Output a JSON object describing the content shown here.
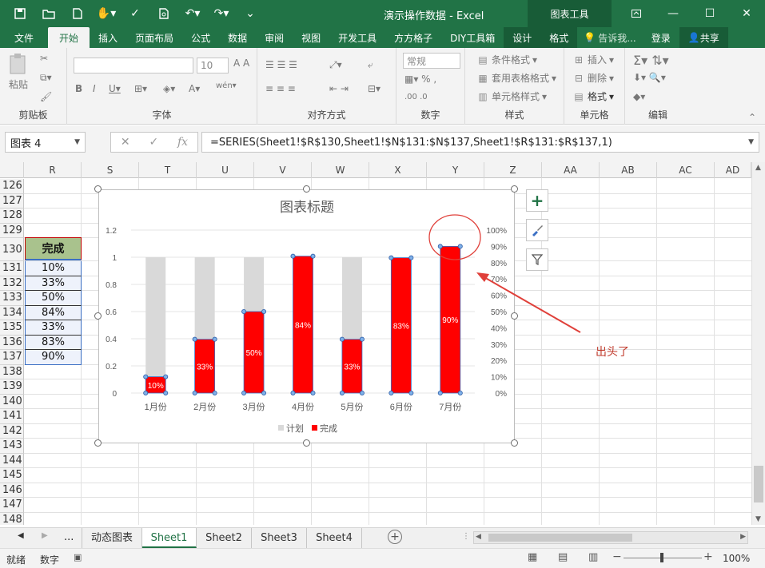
{
  "titlebar": {
    "title": "演示操作数据 - Excel",
    "context_tools": "图表工具"
  },
  "tabs": [
    "文件",
    "开始",
    "插入",
    "页面布局",
    "公式",
    "数据",
    "审阅",
    "视图",
    "开发工具",
    "方方格子",
    "DIY工具箱",
    "设计",
    "格式"
  ],
  "tell_me": "告诉我...",
  "login": "登录",
  "share": "共享",
  "ribbon": {
    "clipboard": {
      "paste": "粘贴",
      "label": "剪贴板"
    },
    "font": {
      "size": "10",
      "label": "字体"
    },
    "align": {
      "label": "对齐方式"
    },
    "number": {
      "format": "常规",
      "label": "数字"
    },
    "styles": {
      "cond": "条件格式",
      "table": "套用表格格式",
      "cell": "单元格样式",
      "label": "样式"
    },
    "cells": {
      "insert": "插入",
      "delete": "删除",
      "format": "格式",
      "label": "单元格"
    },
    "edit": {
      "label": "编辑"
    }
  },
  "namebox": "图表 4",
  "formula": "=SERIES(Sheet1!$R$130,Sheet1!$N$131:$N$137,Sheet1!$R$131:$R$137,1)",
  "columns": [
    "R",
    "S",
    "T",
    "U",
    "V",
    "W",
    "X",
    "Y",
    "Z",
    "AA",
    "AB",
    "AC",
    "AD"
  ],
  "rows": [
    "126",
    "127",
    "128",
    "129",
    "130",
    "131",
    "132",
    "133",
    "134",
    "135",
    "136",
    "137",
    "138",
    "139",
    "140",
    "141",
    "142",
    "143",
    "144",
    "145",
    "146",
    "147",
    "148"
  ],
  "table": {
    "header": "完成",
    "values": [
      "10%",
      "33%",
      "50%",
      "84%",
      "33%",
      "83%",
      "90%"
    ]
  },
  "annotation": "出头了",
  "sheets": [
    "动态图表",
    "Sheet1",
    "Sheet2",
    "Sheet3",
    "Sheet4"
  ],
  "sheet_more": "...",
  "status": {
    "ready": "就绪",
    "num": "数字",
    "zoom": "100%"
  },
  "chart_data": {
    "type": "bar",
    "title": "图表标题",
    "categories": [
      "1月份",
      "2月份",
      "3月份",
      "4月份",
      "5月份",
      "6月份",
      "7月份"
    ],
    "series": [
      {
        "name": "计划",
        "axis": "left",
        "values": [
          1,
          1,
          1,
          1,
          1,
          1,
          1
        ],
        "color": "#d9d9d9"
      },
      {
        "name": "完成",
        "axis": "right",
        "values": [
          0.1,
          0.33,
          0.5,
          0.84,
          0.33,
          0.83,
          0.9
        ],
        "color": "#ff0000"
      }
    ],
    "data_labels": [
      "10%",
      "33%",
      "50%",
      "84%",
      "33%",
      "83%",
      "90%"
    ],
    "yticks_left": [
      "0",
      "0.2",
      "0.4",
      "0.6",
      "0.8",
      "1",
      "1.2"
    ],
    "yticks_right": [
      "0%",
      "10%",
      "20%",
      "30%",
      "40%",
      "50%",
      "60%",
      "70%",
      "80%",
      "90%",
      "100%"
    ],
    "ylim_left": [
      0,
      1.2
    ],
    "ylim_right": [
      0,
      1.0
    ],
    "legend": "bottom"
  }
}
